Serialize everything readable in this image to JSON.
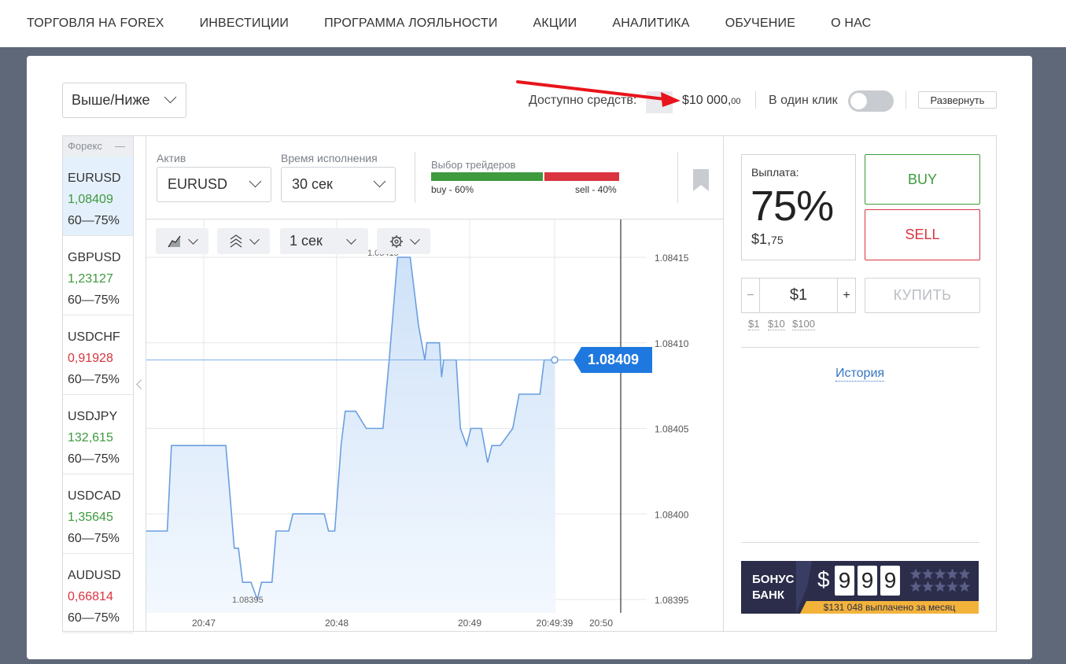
{
  "nav": {
    "items": [
      "ТОРГОВЛЯ НА FOREX",
      "ИНВЕСТИЦИИ",
      "ПРОГРАММА ЛОЯЛЬНОСТИ",
      "АКЦИИ",
      "АНАЛИТИКА",
      "ОБУЧЕНИЕ",
      "О НАС"
    ]
  },
  "mode": {
    "selected": "Выше/Ниже"
  },
  "balance": {
    "label": "Доступно средств:",
    "main": "$10 000,",
    "cents": "00"
  },
  "one_click": {
    "label": "В один клик",
    "enabled": false
  },
  "expand": {
    "label": "Развернуть"
  },
  "assets": {
    "category": "Форекс",
    "collapse_symbol": "—",
    "items": [
      {
        "name": "EURUSD",
        "price": "1,08409",
        "direction": "up",
        "payout": "60—75%",
        "active": true
      },
      {
        "name": "GBPUSD",
        "price": "1,23127",
        "direction": "up",
        "payout": "60—75%",
        "active": false
      },
      {
        "name": "USDCHF",
        "price": "0,91928",
        "direction": "down",
        "payout": "60—75%",
        "active": false
      },
      {
        "name": "USDJPY",
        "price": "132,615",
        "direction": "up",
        "payout": "60—75%",
        "active": false
      },
      {
        "name": "USDCAD",
        "price": "1,35645",
        "direction": "up",
        "payout": "60—75%",
        "active": false
      },
      {
        "name": "AUDUSD",
        "price": "0,66814",
        "direction": "down",
        "payout": "60—75%",
        "active": false
      }
    ]
  },
  "controls": {
    "asset_label": "Актив",
    "asset_value": "EURUSD",
    "expiry_label": "Время исполнения",
    "expiry_value": "30 сек",
    "traders_label": "Выбор трейдеров",
    "buy_share_text": "buy - 60%",
    "sell_share_text": "sell - 40%",
    "buy_share": 60,
    "sell_share": 40,
    "interval_value": "1 сек"
  },
  "chart_data": {
    "type": "line",
    "x_ticks": [
      "20:47",
      "20:48",
      "20:49",
      "20:49:39",
      "20:50"
    ],
    "y_ticks": [
      "1.08415",
      "1.08410",
      "1.08405",
      "1.08400",
      "1.08395"
    ],
    "ylim": [
      1.08393,
      1.08416
    ],
    "xlim_seconds": [
      0,
      202
    ],
    "current_price_label": "1.08409",
    "max_label": "1.08415",
    "min_label": "1.08395",
    "points_t": [
      0,
      10,
      12,
      38,
      40,
      42,
      44,
      46,
      50,
      53,
      55,
      60,
      62,
      63,
      68,
      70,
      78,
      80,
      85,
      87,
      88,
      90,
      93,
      95,
      100,
      105,
      108,
      113,
      116,
      120,
      122,
      123,
      126,
      130,
      133,
      134,
      136,
      140,
      141,
      142,
      144,
      145,
      148,
      150,
      153,
      155,
      160,
      163,
      165,
      169,
      175,
      178,
      180,
      188,
      190,
      195
    ],
    "points_y": [
      1.08399,
      1.08399,
      1.08404,
      1.08404,
      1.08401,
      1.08398,
      1.08398,
      1.08396,
      1.08396,
      1.08395,
      1.08396,
      1.08396,
      1.08399,
      1.08399,
      1.08399,
      1.084,
      1.084,
      1.084,
      1.084,
      1.08399,
      1.08399,
      1.08399,
      1.08404,
      1.08406,
      1.08406,
      1.08405,
      1.08405,
      1.08405,
      1.08409,
      1.08415,
      1.08415,
      1.08415,
      1.08415,
      1.08411,
      1.08409,
      1.0841,
      1.0841,
      1.0841,
      1.08408,
      1.08409,
      1.08409,
      1.08409,
      1.08409,
      1.08405,
      1.08404,
      1.08405,
      1.08405,
      1.08403,
      1.08404,
      1.08404,
      1.08405,
      1.08407,
      1.08407,
      1.08407,
      1.08409,
      1.08409
    ]
  },
  "payout": {
    "label": "Выплата:",
    "percent": "75%",
    "amount_main": "$1,",
    "amount_cents": "75"
  },
  "trade": {
    "buy_label": "BUY",
    "sell_label": "SELL",
    "amount": "$1",
    "minus": "−",
    "plus": "+",
    "quick_amounts": [
      "$1",
      "$10",
      "$100"
    ],
    "purchase_label": "КУПИТЬ"
  },
  "history": {
    "label": "История"
  },
  "bonus": {
    "line1": "БОНУС",
    "line2": "БАНК",
    "currency": "$",
    "digits": [
      "9",
      "9",
      "9"
    ],
    "footer": "$131 048 выплачено за месяц"
  },
  "colors": {
    "up": "#3d9a3d",
    "down": "#d9343f",
    "accent": "#1f78e0",
    "line": "#6a9fe0",
    "bg": "#5f6878"
  }
}
